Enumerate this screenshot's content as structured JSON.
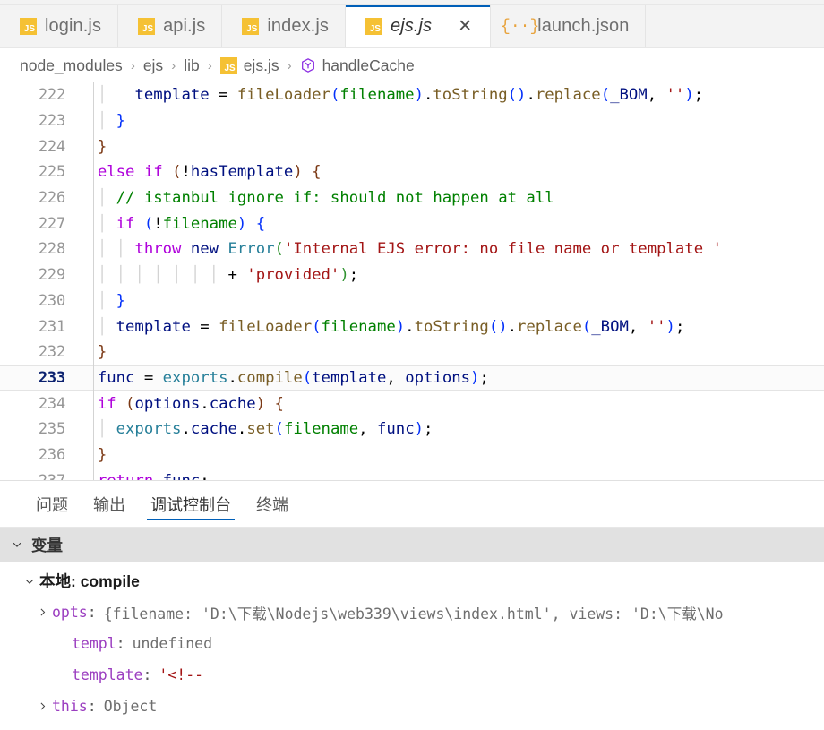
{
  "tabs": [
    {
      "label": "login.js",
      "icon": "js-file-icon",
      "active": false,
      "closable": false
    },
    {
      "label": "api.js",
      "icon": "js-file-icon",
      "active": false,
      "closable": false
    },
    {
      "label": "index.js",
      "icon": "js-file-icon",
      "active": false,
      "closable": false
    },
    {
      "label": "ejs.js",
      "icon": "js-file-icon",
      "active": true,
      "closable": true,
      "close_glyph": "✕"
    },
    {
      "label": "launch.json",
      "icon": "json-file-icon",
      "active": false,
      "closable": false,
      "icon_glyph": "{··}"
    }
  ],
  "breadcrumb": {
    "separator": "›",
    "items": [
      {
        "label": "node_modules",
        "icon": null
      },
      {
        "label": "ejs",
        "icon": null
      },
      {
        "label": "lib",
        "icon": null
      },
      {
        "label": "ejs.js",
        "icon": "js-file-icon"
      },
      {
        "label": "handleCache",
        "icon": "method-symbol-icon"
      }
    ]
  },
  "editor": {
    "language": "javascript",
    "current_line": 233,
    "first_line": 222,
    "last_line": 237,
    "lines": [
      {
        "num": "222",
        "text": "      template = fileLoader(filename).toString().replace(_BOM, '');"
      },
      {
        "num": "223",
        "text": "    }"
      },
      {
        "num": "224",
        "text": "  }"
      },
      {
        "num": "225",
        "text": "  else if (!hasTemplate) {"
      },
      {
        "num": "226",
        "text": "    // istanbul ignore if: should not happen at all"
      },
      {
        "num": "227",
        "text": "    if (!filename) {"
      },
      {
        "num": "228",
        "text": "      throw new Error('Internal EJS error: no file name or template '"
      },
      {
        "num": "229",
        "text": "              + 'provided');"
      },
      {
        "num": "230",
        "text": "    }"
      },
      {
        "num": "231",
        "text": "    template = fileLoader(filename).toString().replace(_BOM, '');"
      },
      {
        "num": "232",
        "text": "  }"
      },
      {
        "num": "233",
        "text": "  func = exports.compile(template, options);"
      },
      {
        "num": "234",
        "text": "  if (options.cache) {"
      },
      {
        "num": "235",
        "text": "    exports.cache.set(filename, func);"
      },
      {
        "num": "236",
        "text": "  }"
      },
      {
        "num": "237",
        "text": "  return func;"
      }
    ]
  },
  "panel": {
    "tabs": [
      {
        "label": "问题",
        "active": false
      },
      {
        "label": "输出",
        "active": false
      },
      {
        "label": "调试控制台",
        "active": true
      },
      {
        "label": "终端",
        "active": false
      }
    ],
    "variables_section": {
      "title": "变量",
      "expanded": true,
      "chevron": "⌄"
    },
    "scope": {
      "label": "本地: compile",
      "expanded": true,
      "chevron": "⌄"
    },
    "variables": [
      {
        "expandable": true,
        "expanded": false,
        "twisty": "›",
        "name": "opts",
        "value": "{filename: 'D:\\下载\\Nodejs\\web339\\views\\index.html', views: 'D:\\下载\\No",
        "indent": 1
      },
      {
        "expandable": false,
        "twisty": "",
        "name": "templ",
        "value": "undefined",
        "indent": 2
      },
      {
        "expandable": false,
        "twisty": "",
        "name": "template",
        "value": "'<!--",
        "value_is_string": true,
        "indent": 2
      },
      {
        "expandable": true,
        "expanded": false,
        "twisty": "›",
        "name": "this",
        "value": "Object",
        "indent": 1
      }
    ]
  },
  "colors": {
    "accent": "#005fb8",
    "js_icon": "#f5c134",
    "json_icon": "#e8a33d",
    "keyword": "#af00db",
    "variable": "#001080",
    "function": "#795e26",
    "string": "#a31515",
    "comment": "#008000",
    "class": "#267f99",
    "var_name": "#9b3ec0"
  }
}
